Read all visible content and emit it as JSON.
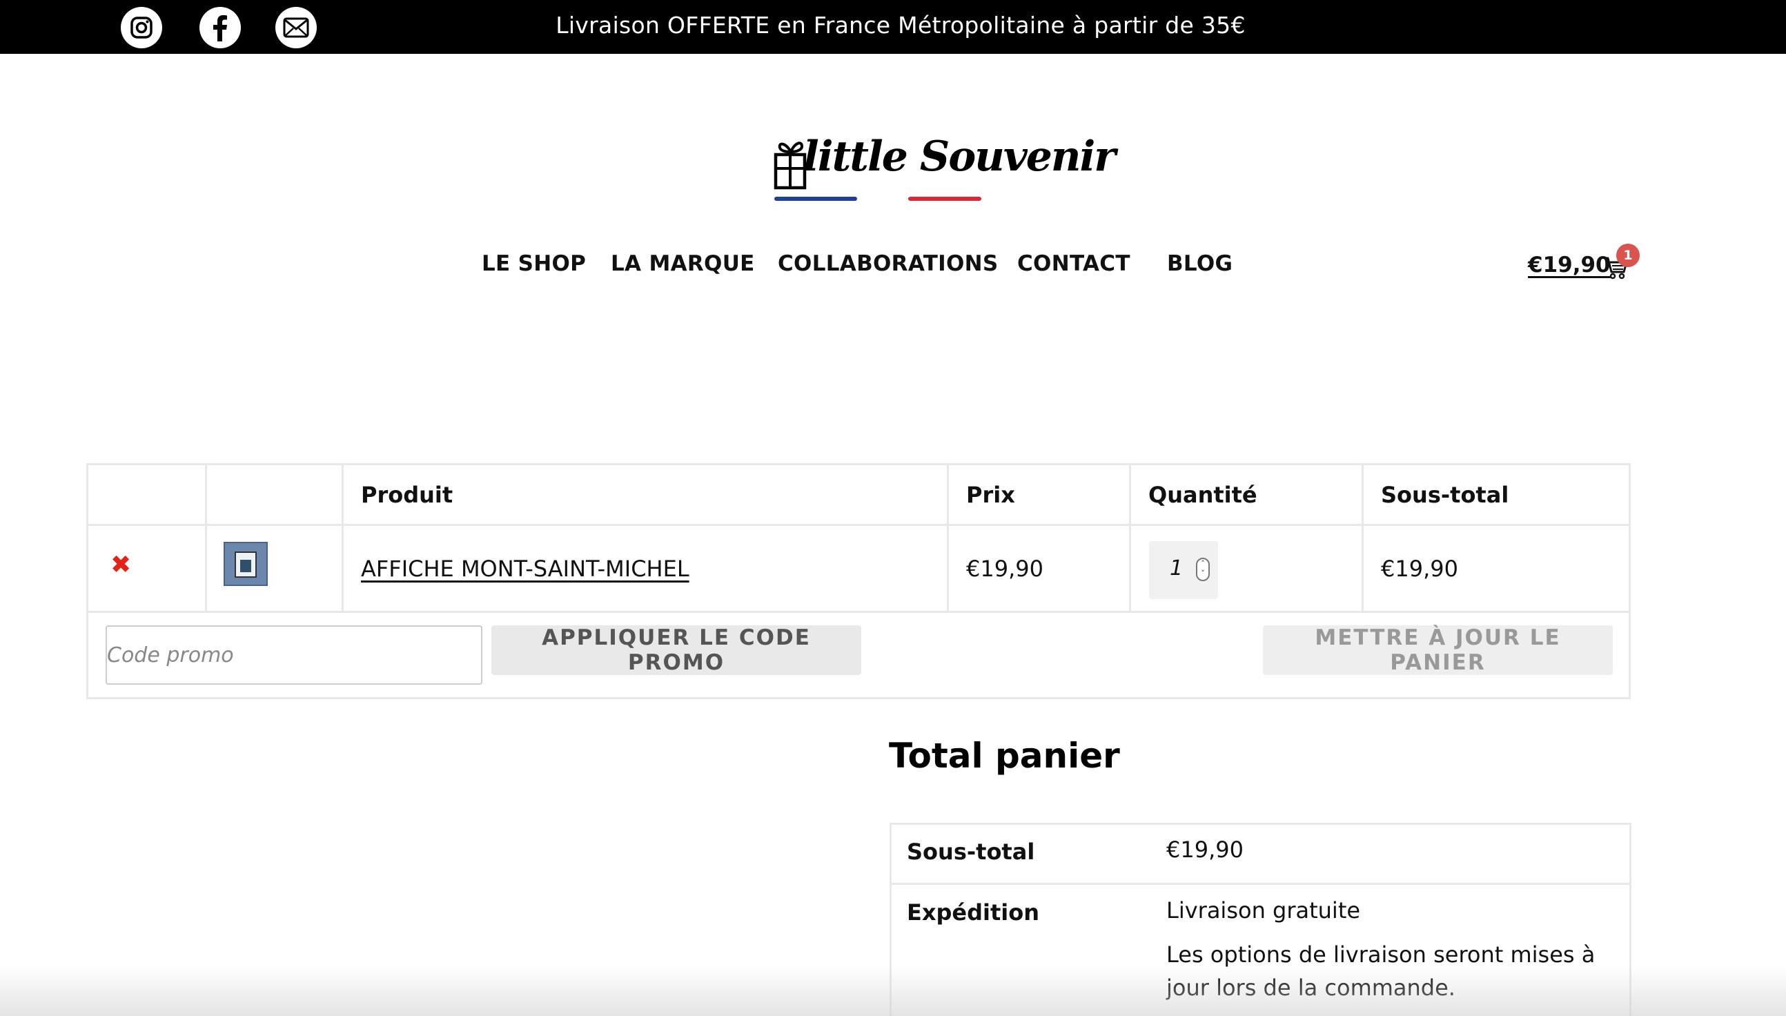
{
  "topbar": {
    "announcement": "Livraison OFFERTE en France Métropolitaine à partir de 35€",
    "social": [
      "instagram-icon",
      "facebook-icon",
      "mail-icon"
    ]
  },
  "logo": {
    "text": "little Souvenir"
  },
  "nav": {
    "items": [
      "LE SHOP",
      "LA MARQUE",
      "COLLABORATIONS",
      "CONTACT",
      "BLOG"
    ],
    "cart_total": "€19,90",
    "cart_count": "1"
  },
  "cart": {
    "headers": {
      "product": "Produit",
      "price": "Prix",
      "quantity": "Quantité",
      "subtotal": "Sous-total"
    },
    "items": [
      {
        "name": "AFFICHE MONT-SAINT-MICHEL",
        "price": "€19,90",
        "quantity": "1",
        "subtotal": "€19,90"
      }
    ],
    "promo_placeholder": "Code promo",
    "apply_label": "APPLIQUER LE CODE PROMO",
    "update_label": "METTRE À JOUR LE PANIER"
  },
  "totals": {
    "title": "Total panier",
    "subtotal_label": "Sous-total",
    "subtotal_value": "€19,90",
    "shipping_label": "Expédition",
    "shipping_value": "Livraison gratuite",
    "shipping_note_line1": "Les options de livraison seront mises à",
    "shipping_note_line2": "jour lors de la commande."
  },
  "colors": {
    "accent_red": "#e2231a",
    "badge": "#d9534f",
    "logo_blue": "#1f3f9a",
    "logo_red": "#d6293a"
  }
}
